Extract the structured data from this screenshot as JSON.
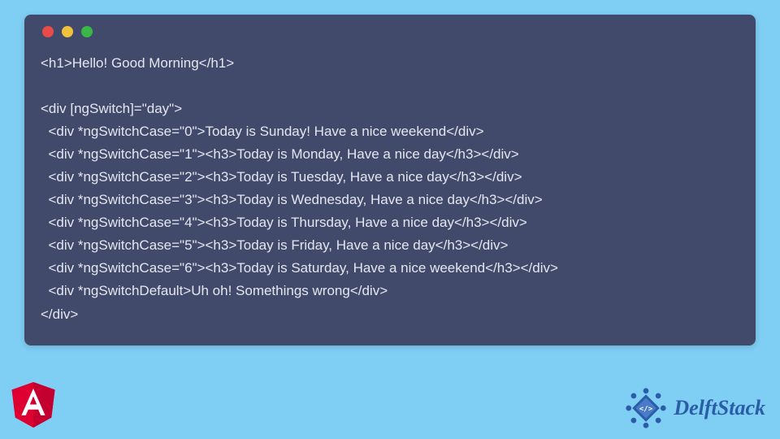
{
  "window": {
    "dots": [
      "red",
      "yellow",
      "green"
    ]
  },
  "code": {
    "lines": [
      "<h1>Hello! Good Morning</h1>",
      "",
      "<div [ngSwitch]=\"day\">",
      "  <div *ngSwitchCase=\"0\">Today is Sunday! Have a nice weekend</div>",
      "  <div *ngSwitchCase=\"1\"><h3>Today is Monday, Have a nice day</h3></div>",
      "  <div *ngSwitchCase=\"2\"><h3>Today is Tuesday, Have a nice day</h3></div>",
      "  <div *ngSwitchCase=\"3\"><h3>Today is Wednesday, Have a nice day</h3></div>",
      "  <div *ngSwitchCase=\"4\"><h3>Today is Thursday, Have a nice day</h3></div>",
      "  <div *ngSwitchCase=\"5\"><h3>Today is Friday, Have a nice day</h3></div>",
      "  <div *ngSwitchCase=\"6\"><h3>Today is Saturday, Have a nice weekend</h3></div>",
      "  <div *ngSwitchDefault>Uh oh! Somethings wrong</div>",
      "</div>"
    ]
  },
  "footer": {
    "brand": "DelftStack"
  }
}
